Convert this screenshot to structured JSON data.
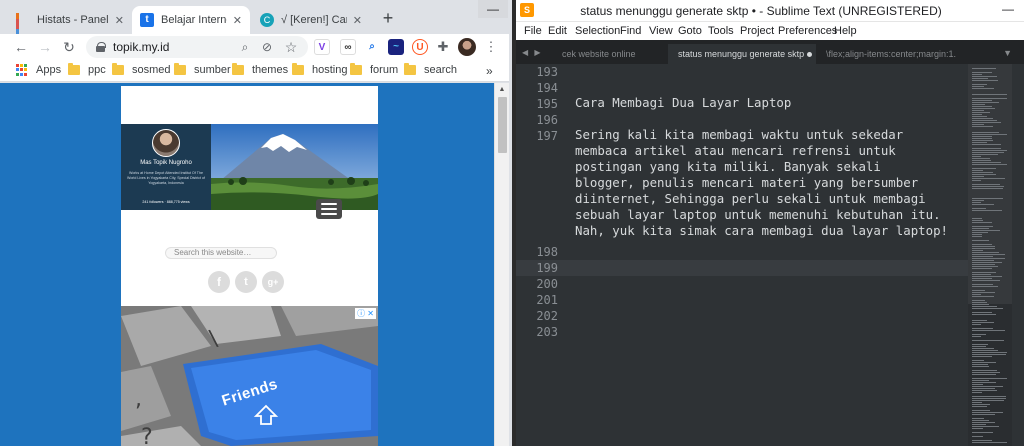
{
  "chrome": {
    "tabs": [
      {
        "title": "Histats - Panel Ke",
        "favicon": "histats-icon"
      },
      {
        "title": "Belajar Internet -",
        "favicon": "topik-icon"
      },
      {
        "title": "√ [Keren!] Cara M",
        "favicon": "teal-icon"
      }
    ],
    "new_tab": "+",
    "window_minimize": "—",
    "address": {
      "url": "topik.my.id"
    },
    "bookmarks": [
      "Apps",
      "ppc",
      "sosmed",
      "sumber",
      "themes",
      "hosting",
      "forum",
      "search"
    ],
    "bookmarks_more": "»",
    "page": {
      "profile_name": "Mas Topik Nugroho",
      "profile_bio": "Works at Home Depot Attended Institut Of The World Lives in Yogyakarta City, Special District of Yogyakarta, Indonesia",
      "profile_stats": "241 followers · 888,775 views",
      "search_placeholder": "Search this website…",
      "social": [
        "f",
        "t",
        "g+"
      ],
      "ad_keyword": "Friends",
      "ad_badge": "ⓘ ✕"
    }
  },
  "sublime": {
    "title": "status menunggu generate sktp • - Sublime Text (UNREGISTERED)",
    "window_minimize": "—",
    "menu": [
      "File",
      "Edit",
      "Selection",
      "Find",
      "View",
      "Goto",
      "Tools",
      "Project",
      "Preferences",
      "Help"
    ],
    "tabs": [
      "cek website online",
      "status menunggu generate sktp",
      "\\flex;align-items:center;margin:1."
    ],
    "lines": [
      {
        "num": "193",
        "text": ""
      },
      {
        "num": "194",
        "text": ""
      },
      {
        "num": "195",
        "text": "Cara Membagi Dua Layar Laptop"
      },
      {
        "num": "196",
        "text": ""
      },
      {
        "num": "197",
        "text": "Sering kali kita membagi waktu untuk sekedar\nmembaca artikel atau mencari refrensi untuk\npostingan yang kita miliki. Banyak sekali\nblogger, penulis mencari materi yang bersumber\ndiinternet, Sehingga perlu sekali untuk membagi\nsebuah layar laptop untuk memenuhi kebutuhan itu.\nNah, yuk kita simak cara membagi dua layar laptop!"
      },
      {
        "num": "198",
        "text": ""
      },
      {
        "num": "199",
        "text": ""
      },
      {
        "num": "200",
        "text": ""
      },
      {
        "num": "201",
        "text": ""
      },
      {
        "num": "202",
        "text": ""
      },
      {
        "num": "203",
        "text": ""
      }
    ]
  },
  "colors": {
    "chrome_page_bg": "#1e73be",
    "sublime_bg": "#2e3235",
    "sublime_text": "#d7dadc",
    "gutter": "#8a8f94"
  }
}
